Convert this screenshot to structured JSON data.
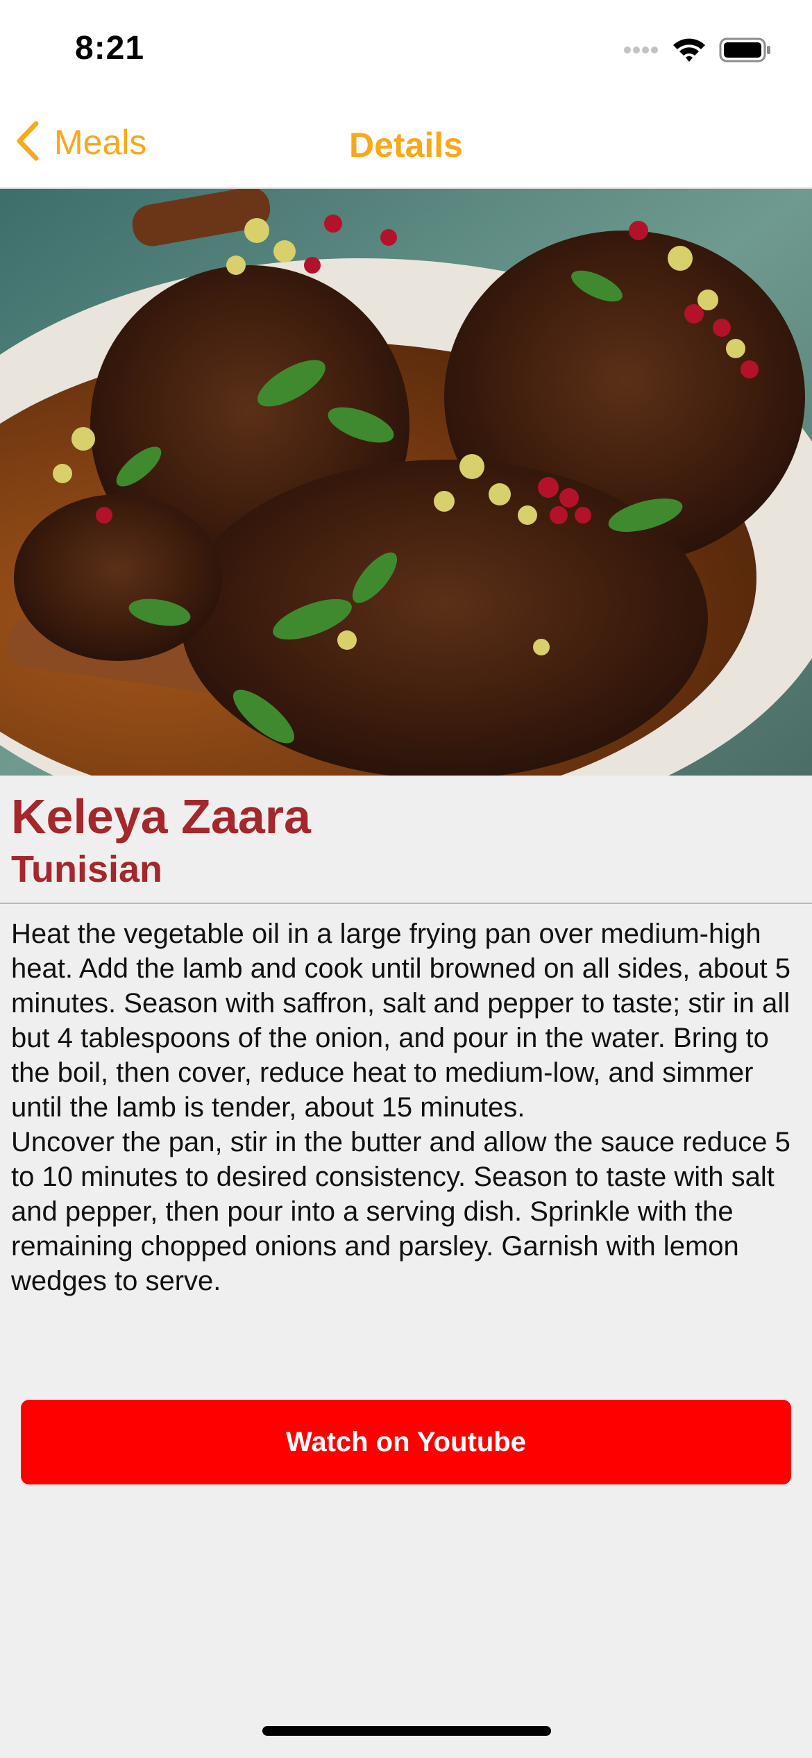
{
  "status_bar": {
    "time": "8:21",
    "icons": [
      "cellular-signal-icon",
      "wifi-icon",
      "battery-icon"
    ]
  },
  "nav": {
    "back_label": "Meals",
    "title": "Details",
    "accent_color": "#f7a81b"
  },
  "meal": {
    "name": "Keleya Zaara",
    "area": "Tunisian",
    "title_color": "#a3272b",
    "instructions": "Heat the vegetable oil in a large frying pan over medium-high heat. Add the lamb and cook until browned on all sides, about 5 minutes. Season with saffron, salt and pepper to taste; stir in all but 4 tablespoons of the onion, and pour in the water. Bring to the boil, then cover, reduce heat to medium-low, and simmer until the lamb is tender, about 15 minutes.\nUncover the pan, stir in the butter and allow the sauce reduce 5 to 10 minutes to desired consistency. Season to taste with salt and pepper, then pour into a serving dish. Sprinkle with the remaining chopped onions and parsley. Garnish with lemon wedges to serve."
  },
  "actions": {
    "youtube_label": "Watch on Youtube",
    "youtube_color": "#ff0000"
  }
}
